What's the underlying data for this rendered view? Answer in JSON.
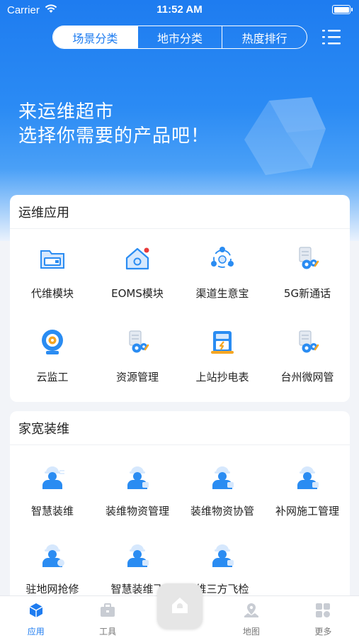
{
  "status_bar": {
    "carrier": "Carrier",
    "time": "11:52 AM"
  },
  "header": {
    "tabs": [
      {
        "label": "场景分类",
        "active": true
      },
      {
        "label": "地市分类",
        "active": false
      },
      {
        "label": "热度排行",
        "active": false
      }
    ],
    "menu_icon": "list-menu-icon"
  },
  "banner": {
    "line1": "来运维超市",
    "line2": "选择你需要的产品吧！"
  },
  "sections": [
    {
      "title": "运维应用",
      "items": [
        {
          "label": "代维模块",
          "icon": "folder-icon"
        },
        {
          "label": "EOMS模块",
          "icon": "home-settings-icon"
        },
        {
          "label": "渠道生意宝",
          "icon": "network-cycle-icon"
        },
        {
          "label": "5G新通话",
          "icon": "doc-gear-icon"
        },
        {
          "label": "云监工",
          "icon": "webcam-icon"
        },
        {
          "label": "资源管理",
          "icon": "doc-gear-icon"
        },
        {
          "label": "上站抄电表",
          "icon": "meter-icon"
        },
        {
          "label": "台州微网管",
          "icon": "doc-gear-icon"
        }
      ]
    },
    {
      "title": "家宽装维",
      "items": [
        {
          "label": "智慧装维",
          "icon": "worker-icon"
        },
        {
          "label": "装维物资管理",
          "icon": "worker-icon"
        },
        {
          "label": "装维物资协管",
          "icon": "worker-icon"
        },
        {
          "label": "补网施工管理",
          "icon": "worker-icon"
        },
        {
          "label": "驻地网抢修",
          "icon": "worker-icon"
        },
        {
          "label": "智慧装维飞",
          "icon": "worker-icon"
        },
        {
          "label": "维三方飞检",
          "icon": "worker-icon"
        }
      ]
    }
  ],
  "tab_bar": [
    {
      "label": "应用",
      "icon": "cube-icon",
      "active": true
    },
    {
      "label": "工具",
      "icon": "toolbox-icon",
      "active": false
    },
    {
      "label": "",
      "icon": "home-icon",
      "active": false
    },
    {
      "label": "地图",
      "icon": "map-pin-icon",
      "active": false
    },
    {
      "label": "更多",
      "icon": "grid-more-icon",
      "active": false
    }
  ],
  "colors": {
    "primary": "#1e7cf0",
    "icon_blue": "#2a8cf2",
    "accent_orange": "#f5a623"
  }
}
